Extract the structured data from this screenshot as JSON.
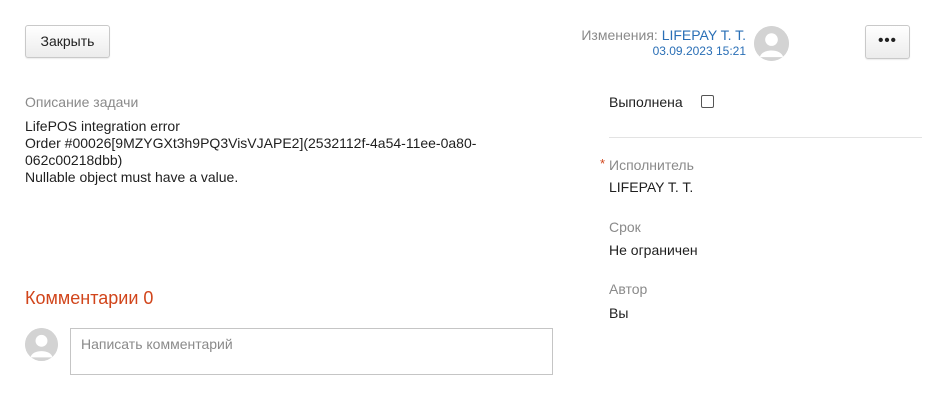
{
  "toolbar": {
    "close_label": "Закрыть",
    "more_label": "•••"
  },
  "changes": {
    "label": "Изменения:",
    "user": "LIFEPAY T. T.",
    "date": "03.09.2023 15:21"
  },
  "description": {
    "label": "Описание задачи",
    "lines": [
      "LifePOS integration error",
      "Order #00026[9MZYGXt3h9PQ3VisVJAPE2](2532112f-4a54-11ee-0a80-",
      "062c00218dbb)",
      "Nullable object must have a value."
    ]
  },
  "comments": {
    "title": "Комментарии 0",
    "placeholder": "Написать комментарий"
  },
  "sidebar": {
    "done_label": "Выполнена",
    "done_checked": false,
    "assignee_required_mark": "*",
    "assignee_label": "Исполнитель",
    "assignee_value": "LIFEPAY T. T.",
    "deadline_label": "Срок",
    "deadline_value": "Не ограничен",
    "author_label": "Автор",
    "author_value": "Вы"
  },
  "colors": {
    "accent": "#d1451b",
    "link": "#2a6fb6",
    "muted": "#8a8a8a"
  }
}
